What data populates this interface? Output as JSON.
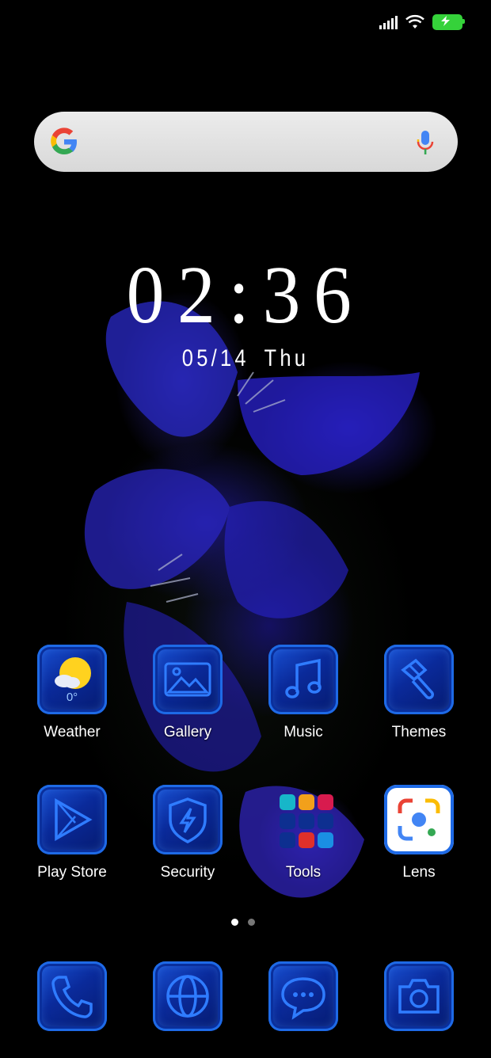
{
  "status_bar": {
    "signal_icon": "cellular-signal-icon",
    "wifi_icon": "wifi-icon",
    "battery_icon": "battery-charging-icon",
    "battery_color": "#35d23a"
  },
  "search_widget": {
    "logo_icon": "google-g-icon",
    "mic_icon": "microphone-icon"
  },
  "clock": {
    "time": "02:36",
    "date": "05/14",
    "weekday": "Thu"
  },
  "apps": {
    "weather": {
      "label": "Weather",
      "temperature": "0°"
    },
    "gallery": {
      "label": "Gallery"
    },
    "music": {
      "label": "Music"
    },
    "themes": {
      "label": "Themes"
    },
    "play_store": {
      "label": "Play Store"
    },
    "security": {
      "label": "Security"
    },
    "tools": {
      "label": "Tools"
    },
    "lens": {
      "label": "Lens"
    }
  },
  "page_indicator": {
    "pages": 2,
    "current": 1
  },
  "dock": {
    "items": [
      "phone-icon",
      "browser-icon",
      "messages-icon",
      "camera-icon"
    ]
  },
  "colors": {
    "tile_blue": "#1a54d8",
    "tile_border": "#1e6ae6"
  }
}
